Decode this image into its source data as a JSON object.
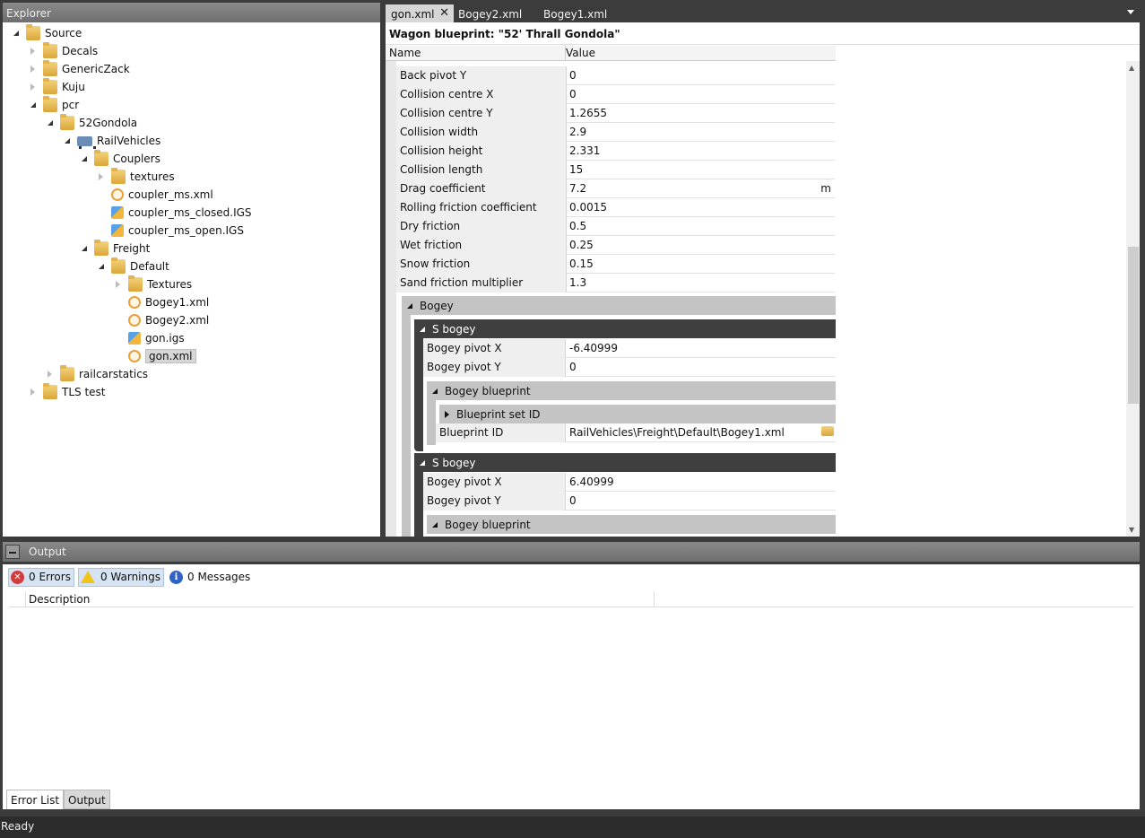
{
  "explorer": {
    "title": "Explorer",
    "tree": [
      {
        "label": "Source",
        "icon": "folder-icon",
        "exp": "open",
        "name": "tree-source"
      },
      {
        "label": "Decals",
        "icon": "folder-icon",
        "exp": "closed",
        "name": "tree-decals"
      },
      {
        "label": "GenericZack",
        "icon": "folder-icon",
        "exp": "closed",
        "name": "tree-genericzack"
      },
      {
        "label": "Kuju",
        "icon": "folder-icon",
        "exp": "closed",
        "name": "tree-kuju"
      },
      {
        "label": "pcr",
        "icon": "folder-icon",
        "exp": "open",
        "name": "tree-pcr"
      },
      {
        "label": "52Gondola",
        "icon": "folder-icon",
        "exp": "open",
        "name": "tree-52gondola"
      },
      {
        "label": "RailVehicles",
        "icon": "wagon-icon",
        "exp": "open",
        "name": "tree-railvehicles"
      },
      {
        "label": "Couplers",
        "icon": "folder-icon",
        "exp": "open",
        "name": "tree-couplers"
      },
      {
        "label": "textures",
        "icon": "folder-icon",
        "exp": "closed",
        "name": "tree-textures-lower"
      },
      {
        "label": "coupler_ms.xml",
        "icon": "xml-file-icon",
        "exp": "none",
        "name": "tree-coupler-ms-xml"
      },
      {
        "label": "coupler_ms_closed.IGS",
        "icon": "igs-file-icon",
        "exp": "none",
        "name": "tree-coupler-ms-closed-igs"
      },
      {
        "label": "coupler_ms_open.IGS",
        "icon": "igs-file-icon",
        "exp": "none",
        "name": "tree-coupler-ms-open-igs"
      },
      {
        "label": "Freight",
        "icon": "folder-icon",
        "exp": "open",
        "name": "tree-freight"
      },
      {
        "label": "Default",
        "icon": "folder-icon",
        "exp": "open",
        "name": "tree-default"
      },
      {
        "label": "Textures",
        "icon": "folder-icon",
        "exp": "closed",
        "name": "tree-textures"
      },
      {
        "label": "Bogey1.xml",
        "icon": "xml-file-icon",
        "exp": "none",
        "name": "tree-bogey1-xml"
      },
      {
        "label": "Bogey2.xml",
        "icon": "xml-file-icon",
        "exp": "none",
        "name": "tree-bogey2-xml"
      },
      {
        "label": "gon.igs",
        "icon": "igs-file-icon",
        "exp": "none",
        "name": "tree-gon-igs"
      },
      {
        "label": "gon.xml",
        "icon": "xml-file-icon",
        "exp": "none",
        "name": "tree-gon-xml",
        "selected": true
      },
      {
        "label": "railcarstatics",
        "icon": "folder-icon",
        "exp": "closed",
        "name": "tree-railcarstatics"
      },
      {
        "label": "TLS test",
        "icon": "folder-icon",
        "exp": "closed",
        "name": "tree-tls-test"
      }
    ]
  },
  "tabs": {
    "active": "gon.xml",
    "close_glyph": "✕",
    "others": [
      "Bogey2.xml",
      "Bogey1.xml"
    ]
  },
  "editor": {
    "title": "Wagon blueprint: \"52' Thrall Gondola\"",
    "col_name": "Name",
    "col_value": "Value",
    "properties": [
      {
        "name": "Back pivot Y",
        "value": "0"
      },
      {
        "name": "Collision centre X",
        "value": "0"
      },
      {
        "name": "Collision centre Y",
        "value": "1.2655"
      },
      {
        "name": "Collision width",
        "value": "2.9"
      },
      {
        "name": "Collision height",
        "value": "2.331"
      },
      {
        "name": "Collision length",
        "value": "15"
      },
      {
        "name": "Drag coefficient",
        "value": "7.2",
        "unit": "m"
      },
      {
        "name": "Rolling friction coefficient",
        "value": "0.0015"
      },
      {
        "name": "Dry friction",
        "value": "0.5"
      },
      {
        "name": "Wet friction",
        "value": "0.25"
      },
      {
        "name": "Snow friction",
        "value": "0.15"
      },
      {
        "name": "Sand friction multiplier",
        "value": "1.3"
      }
    ],
    "bogey_section": "Bogey",
    "s_bogey_1": {
      "title": "S bogey",
      "pivot_x_label": "Bogey pivot X",
      "pivot_x": "-6.40999",
      "pivot_y_label": "Bogey pivot Y",
      "pivot_y": "0",
      "blueprint_label": "Bogey blueprint",
      "set_id_label": "Blueprint set ID",
      "blueprint_id_label": "Blueprint ID",
      "blueprint_id": "RailVehicles\\Freight\\Default\\Bogey1.xml"
    },
    "s_bogey_2": {
      "title": "S bogey",
      "pivot_x_label": "Bogey pivot X",
      "pivot_x": "6.40999",
      "pivot_y_label": "Bogey pivot Y",
      "pivot_y": "0",
      "blueprint_label": "Bogey blueprint"
    }
  },
  "output": {
    "title": "Output",
    "errors": "0 Errors",
    "warnings": "0 Warnings",
    "messages": "0 Messages",
    "error_glyph": "✕",
    "info_glyph": "i",
    "col_description": "Description",
    "tab_error_list": "Error List",
    "tab_output": "Output"
  },
  "status": "Ready"
}
